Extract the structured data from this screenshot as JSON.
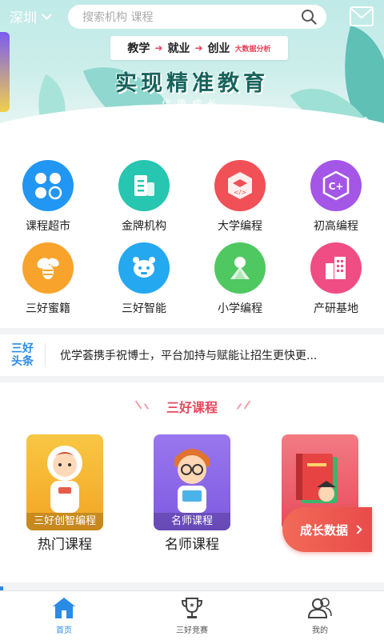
{
  "header": {
    "city": "深圳",
    "search_placeholder": "搜索机构 课程"
  },
  "banner": {
    "tag_items": [
      "教学",
      "就业",
      "创业"
    ],
    "tag_note": "大数据分析",
    "title": "实现精准教育",
    "subtitle": "优质成长",
    "page_count": 4,
    "active_page": 1
  },
  "grid": {
    "items": [
      {
        "label": "课程超市",
        "icon": "clover-icon",
        "color": "#2196f3"
      },
      {
        "label": "金牌机构",
        "icon": "building-icon",
        "color": "#26c6b0"
      },
      {
        "label": "大学编程",
        "icon": "code-hexagon-icon",
        "color": "#f05056"
      },
      {
        "label": "初高编程",
        "icon": "cplus-hexagon-icon",
        "color": "#a456e6"
      },
      {
        "label": "三好蜜籍",
        "icon": "bee-icon",
        "color": "#f8a42c"
      },
      {
        "label": "三好智能",
        "icon": "robot-icon",
        "color": "#24a8ef"
      },
      {
        "label": "小学编程",
        "icon": "tree-icon",
        "color": "#4fc861"
      },
      {
        "label": "产研基地",
        "icon": "city-icon",
        "color": "#f04d84"
      }
    ]
  },
  "news": {
    "logo_line1": "三好",
    "logo_line2": "头条",
    "text": "优学荟携手祝博士，平台加持与赋能让招生更快更..."
  },
  "courses": {
    "section_title": "三好课程",
    "cards": [
      {
        "caption": "三好创智编程",
        "name": "热门课程",
        "color": "#f5b12f"
      },
      {
        "caption": "名师课程",
        "name": "名师课程",
        "color": "#8f6be8"
      },
      {
        "caption": "",
        "name": "",
        "color": "#e84c5a"
      }
    ],
    "growth_label": "成长数据"
  },
  "tabbar": {
    "tabs": [
      {
        "label": "首页",
        "icon": "home-icon",
        "active": true
      },
      {
        "label": "三好竞赛",
        "icon": "trophy-icon",
        "active": false
      },
      {
        "label": "我的",
        "icon": "user-icon",
        "active": false
      }
    ]
  },
  "colors": {
    "accent": "#2a8be6",
    "highlight": "#e5495d"
  }
}
